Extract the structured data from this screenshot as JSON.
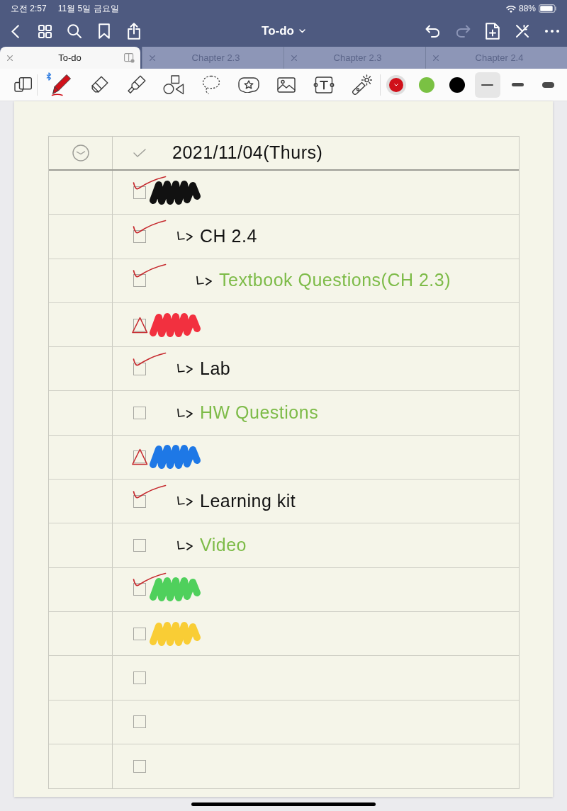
{
  "status_bar": {
    "time": "오전 2:57",
    "date": "11월 5일 금요일",
    "battery": "88%"
  },
  "nav": {
    "title": "To-do",
    "redo": {
      "disabled": true
    }
  },
  "tabs": [
    {
      "title": "To-do",
      "selected": true
    },
    {
      "title": "Chapter 2.3",
      "selected": false
    },
    {
      "title": "Chapter 2.3",
      "selected": false
    },
    {
      "title": "Chapter 2.4",
      "selected": false
    }
  ],
  "toolbar": {
    "colors": [
      {
        "color": "#d0101a",
        "selected": true
      },
      {
        "color": "#7ac143",
        "selected": false
      },
      {
        "color": "#000000",
        "selected": false
      }
    ],
    "stroke_widths": [
      {
        "selected": true
      },
      {
        "selected": false
      },
      {
        "selected": false
      }
    ]
  },
  "page": {
    "header": {
      "date": "2021/11/04(Thurs)"
    },
    "tasks": [
      {
        "kind": "scribble",
        "color": "#111111",
        "checked": true,
        "in_progress": false,
        "children": [
          {
            "kind": "text",
            "text": "CH 2.4",
            "color": "#111111",
            "checked": true,
            "in_progress": false,
            "children": [
              {
                "kind": "text",
                "text": "Textbook Questions(CH 2.3)",
                "color": "#7dbb48",
                "checked": true,
                "in_progress": false
              }
            ]
          }
        ]
      },
      {
        "kind": "scribble",
        "color": "#f2303f",
        "checked": false,
        "in_progress": true,
        "children": [
          {
            "kind": "text",
            "text": "Lab",
            "color": "#111111",
            "checked": true,
            "in_progress": false
          },
          {
            "kind": "text",
            "text": "HW Questions",
            "color": "#7dbb48",
            "checked": false,
            "in_progress": false
          }
        ]
      },
      {
        "kind": "scribble",
        "color": "#1e78e6",
        "checked": false,
        "in_progress": true,
        "children": [
          {
            "kind": "text",
            "text": "Learning kit",
            "color": "#111111",
            "checked": true,
            "in_progress": false
          },
          {
            "kind": "text",
            "text": "Video",
            "color": "#7dbb48",
            "checked": false,
            "in_progress": false
          }
        ]
      },
      {
        "kind": "scribble",
        "color": "#4fd05c",
        "checked": true,
        "in_progress": false
      },
      {
        "kind": "scribble",
        "color": "#f9cd35",
        "checked": false,
        "in_progress": false
      },
      {
        "kind": "blank",
        "checked": false,
        "in_progress": false
      },
      {
        "kind": "blank",
        "checked": false,
        "in_progress": false
      },
      {
        "kind": "blank",
        "checked": false,
        "in_progress": false
      }
    ]
  }
}
